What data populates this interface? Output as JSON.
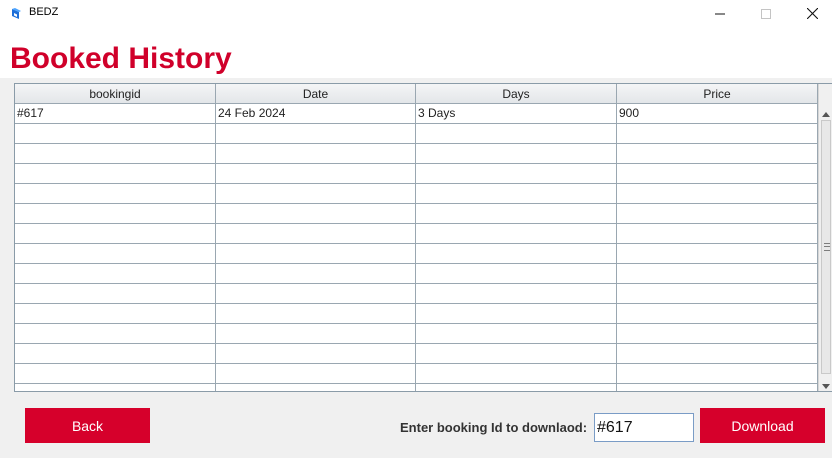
{
  "window": {
    "title": "BEDZ",
    "icon": "bedz-app-icon",
    "controls": [
      "minimize-icon",
      "maximize-icon",
      "close-icon"
    ]
  },
  "page": {
    "title": "Booked History",
    "title_color": "#d0002a"
  },
  "table": {
    "columns": [
      "bookingid",
      "Date",
      "Days",
      "Price"
    ],
    "rows": [
      [
        "#617",
        "24 Feb 2024",
        "3 Days",
        "900"
      ],
      [
        "",
        "",
        "",
        ""
      ],
      [
        "",
        "",
        "",
        ""
      ],
      [
        "",
        "",
        "",
        ""
      ],
      [
        "",
        "",
        "",
        ""
      ],
      [
        "",
        "",
        "",
        ""
      ],
      [
        "",
        "",
        "",
        ""
      ],
      [
        "",
        "",
        "",
        ""
      ],
      [
        "",
        "",
        "",
        ""
      ],
      [
        "",
        "",
        "",
        ""
      ],
      [
        "",
        "",
        "",
        ""
      ],
      [
        "",
        "",
        "",
        ""
      ],
      [
        "",
        "",
        "",
        ""
      ],
      [
        "",
        "",
        "",
        ""
      ],
      [
        "",
        "",
        "",
        ""
      ]
    ]
  },
  "footer": {
    "back_label": "Back",
    "download_prompt": "Enter booking Id to downlaod:",
    "booking_id_value": "#617",
    "download_label": "Download",
    "button_color": "#d6002b"
  }
}
